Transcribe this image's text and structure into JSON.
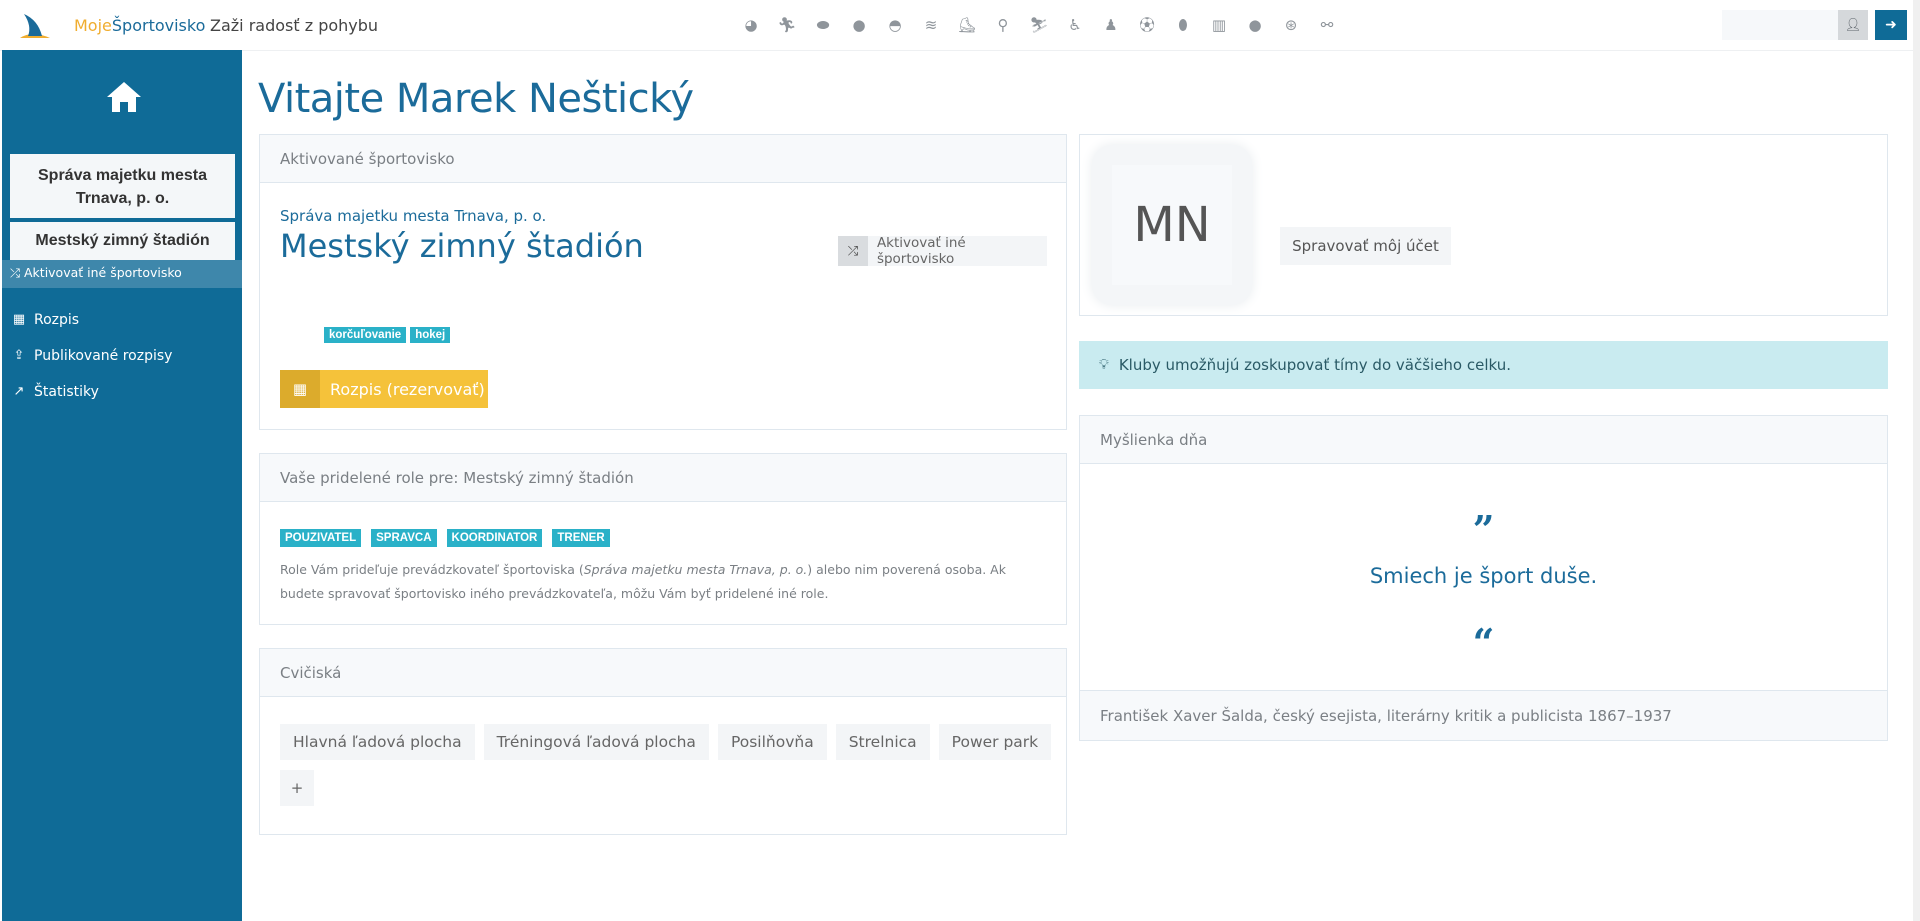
{
  "header": {
    "brand_part1": "Moje",
    "brand_part2": "Športovisko",
    "tagline": "Zaži radosť z pohybu",
    "sport_icons": [
      "volleyball-icon",
      "running-icon",
      "hockey-puck-icon",
      "basketball-icon",
      "ball-sport-icon",
      "swimming-icon",
      "skating-icon",
      "athletics-icon",
      "skiing-icon",
      "skater-icon",
      "table-tennis-icon",
      "football-icon",
      "rugby-icon",
      "weightlifting-icon",
      "bowling-icon",
      "basketball-2-icon",
      "cycling-icon"
    ],
    "search_value": ""
  },
  "sidebar": {
    "org_name": "Správa majetku mesta Trnava, p. o.",
    "venue_name": "Mestský zimný štadión",
    "activate_other": "Aktivovať iné športovisko",
    "items": [
      {
        "label": "Rozpis",
        "icon": "calendar-icon"
      },
      {
        "label": "Publikované rozpisy",
        "icon": "upload-icon"
      },
      {
        "label": "Štatistiky",
        "icon": "chart-icon"
      }
    ]
  },
  "main": {
    "title": "Vitajte Marek Neštický",
    "venue_panel": {
      "header": "Aktivované športovisko",
      "org": "Správa majetku mesta Trnava, p. o.",
      "name": "Mestský zimný štadión",
      "activate_other": "Aktivovať iné športovisko",
      "tags": [
        "korčuľovanie",
        "hokej"
      ],
      "schedule_button": "Rozpis (rezervovať)"
    },
    "roles_panel": {
      "header": "Vaše pridelené role pre: Mestský zimný štadión",
      "roles": [
        "POUZIVATEL",
        "SPRAVCA",
        "KOORDINATOR",
        "TRENER"
      ],
      "text_before": "Role Vám prideľuje prevádzkovateľ športoviska (",
      "text_italic": "Správa majetku mesta Trnava, p. o.",
      "text_after": ") alebo nim poverená osoba. Ak budete spravovať športovisko iného prevádzkovateľa, môžu Vám byť pridelené iné role."
    },
    "places_panel": {
      "header": "Cvičiská",
      "places": [
        "Hlavná ľadová plocha",
        "Tréningová ľadová plocha",
        "Posilňovňa",
        "Strelnica",
        "Power park"
      ],
      "add_label": "+"
    }
  },
  "right": {
    "avatar_initials": "MN",
    "manage_account": "Spravovať môj účet",
    "tip": "Kluby umožňujú zoskupovať tímy do väčšieho celku.",
    "quote_panel": {
      "header": "Myšlienka dňa",
      "open_mark": "”",
      "text": "Smiech je šport duše.",
      "close_mark": "“",
      "author": "František Xaver Šalda, český esejista, literárny kritik a publicista 1867–1937"
    }
  },
  "colors": {
    "primary": "#0f6b97",
    "accent": "#f5c23a",
    "tag": "#2ab1c8",
    "tip_bg": "#c9ebf0"
  }
}
